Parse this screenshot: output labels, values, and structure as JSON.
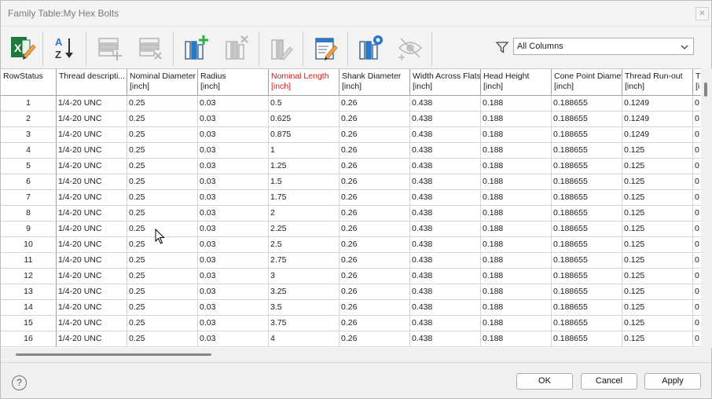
{
  "window": {
    "title": "Family Table:My Hex Bolts",
    "close_label": "✕"
  },
  "toolbar": {
    "buttons": [
      {
        "name": "excel-export-icon",
        "enabled": true
      },
      {
        "name": "sort-az-icon",
        "enabled": true
      },
      {
        "name": "add-row-icon",
        "enabled": false
      },
      {
        "name": "delete-row-icon",
        "enabled": false
      },
      {
        "name": "add-column-icon",
        "enabled": true
      },
      {
        "name": "delete-column-icon",
        "enabled": false
      },
      {
        "name": "edit-column-icon",
        "enabled": false
      },
      {
        "name": "edit-document-icon",
        "enabled": true
      },
      {
        "name": "column-settings-icon",
        "enabled": true
      },
      {
        "name": "visibility-icon",
        "enabled": false
      }
    ],
    "filter": {
      "selected": "All Columns"
    }
  },
  "table": {
    "columns": [
      {
        "label": "RowStatus",
        "unit": ""
      },
      {
        "label": "Thread descripti...",
        "unit": ""
      },
      {
        "label": "Nominal Diameter",
        "unit": "[inch]"
      },
      {
        "label": "Radius",
        "unit": "[inch]"
      },
      {
        "label": "Nominal Length",
        "unit": "[inch]",
        "highlight": true
      },
      {
        "label": "Shank Diameter",
        "unit": "[inch]"
      },
      {
        "label": "Width Across Flats",
        "unit": "[inch]"
      },
      {
        "label": "Head Height",
        "unit": "[inch]"
      },
      {
        "label": "Cone Point Diameter",
        "unit": "[inch]"
      },
      {
        "label": "Thread Run-out",
        "unit": "[inch]"
      },
      {
        "label": "T",
        "unit": "[i"
      }
    ],
    "rows": [
      [
        "1",
        "1/4-20 UNC",
        "0.25",
        "0.03",
        "0.5",
        "0.26",
        "0.438",
        "0.188",
        "0.188655",
        "0.1249",
        "0"
      ],
      [
        "2",
        "1/4-20 UNC",
        "0.25",
        "0.03",
        "0.625",
        "0.26",
        "0.438",
        "0.188",
        "0.188655",
        "0.1249",
        "0"
      ],
      [
        "3",
        "1/4-20 UNC",
        "0.25",
        "0.03",
        "0.875",
        "0.26",
        "0.438",
        "0.188",
        "0.188655",
        "0.1249",
        "0"
      ],
      [
        "4",
        "1/4-20 UNC",
        "0.25",
        "0.03",
        "1",
        "0.26",
        "0.438",
        "0.188",
        "0.188655",
        "0.125",
        "0"
      ],
      [
        "5",
        "1/4-20 UNC",
        "0.25",
        "0.03",
        "1.25",
        "0.26",
        "0.438",
        "0.188",
        "0.188655",
        "0.125",
        "0"
      ],
      [
        "6",
        "1/4-20 UNC",
        "0.25",
        "0.03",
        "1.5",
        "0.26",
        "0.438",
        "0.188",
        "0.188655",
        "0.125",
        "0"
      ],
      [
        "7",
        "1/4-20 UNC",
        "0.25",
        "0.03",
        "1.75",
        "0.26",
        "0.438",
        "0.188",
        "0.188655",
        "0.125",
        "0"
      ],
      [
        "8",
        "1/4-20 UNC",
        "0.25",
        "0.03",
        "2",
        "0.26",
        "0.438",
        "0.188",
        "0.188655",
        "0.125",
        "0"
      ],
      [
        "9",
        "1/4-20 UNC",
        "0.25",
        "0.03",
        "2.25",
        "0.26",
        "0.438",
        "0.188",
        "0.188655",
        "0.125",
        "0"
      ],
      [
        "10",
        "1/4-20 UNC",
        "0.25",
        "0.03",
        "2.5",
        "0.26",
        "0.438",
        "0.188",
        "0.188655",
        "0.125",
        "0"
      ],
      [
        "11",
        "1/4-20 UNC",
        "0.25",
        "0.03",
        "2.75",
        "0.26",
        "0.438",
        "0.188",
        "0.188655",
        "0.125",
        "0"
      ],
      [
        "12",
        "1/4-20 UNC",
        "0.25",
        "0.03",
        "3",
        "0.26",
        "0.438",
        "0.188",
        "0.188655",
        "0.125",
        "0"
      ],
      [
        "13",
        "1/4-20 UNC",
        "0.25",
        "0.03",
        "3.25",
        "0.26",
        "0.438",
        "0.188",
        "0.188655",
        "0.125",
        "0"
      ],
      [
        "14",
        "1/4-20 UNC",
        "0.25",
        "0.03",
        "3.5",
        "0.26",
        "0.438",
        "0.188",
        "0.188655",
        "0.125",
        "0"
      ],
      [
        "15",
        "1/4-20 UNC",
        "0.25",
        "0.03",
        "3.75",
        "0.26",
        "0.438",
        "0.188",
        "0.188655",
        "0.125",
        "0"
      ],
      [
        "16",
        "1/4-20 UNC",
        "0.25",
        "0.03",
        "4",
        "0.26",
        "0.438",
        "0.188",
        "0.188655",
        "0.125",
        "0"
      ]
    ]
  },
  "footer": {
    "help_label": "?",
    "ok_label": "OK",
    "cancel_label": "Cancel",
    "apply_label": "Apply"
  },
  "colors": {
    "highlight_header": "#d21a1a",
    "accent_green": "#2bb34a",
    "accent_blue": "#2a78c8",
    "excel_green": "#1e7a3c"
  }
}
